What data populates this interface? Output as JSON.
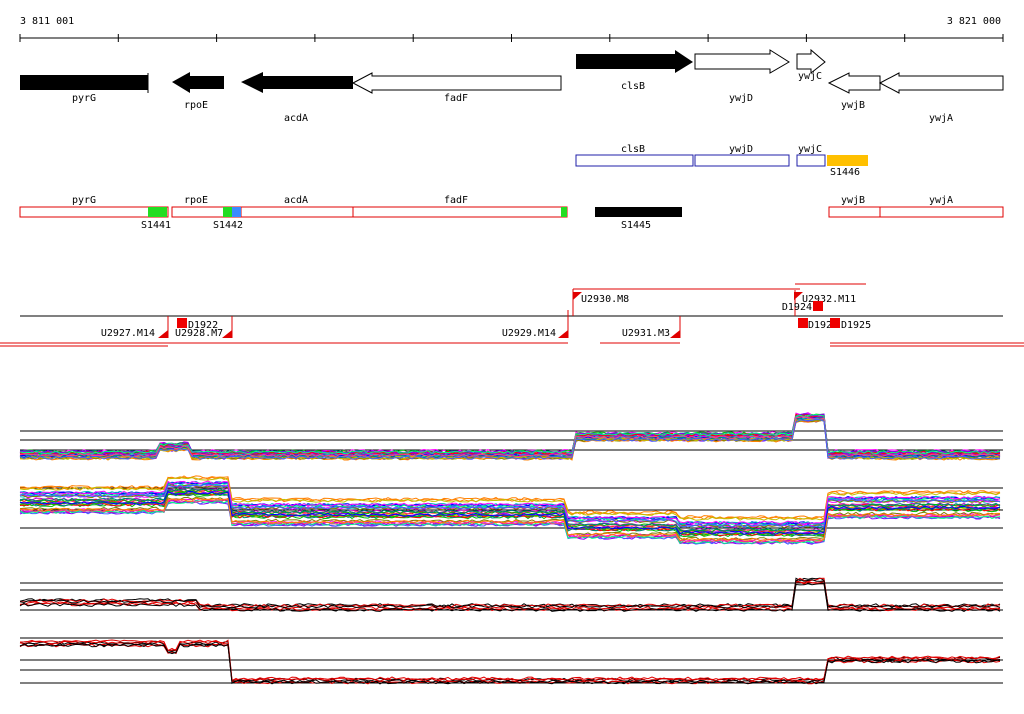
{
  "ruler": {
    "start_label": "3 811 001",
    "end_label": "3 821 000"
  },
  "genes": [
    {
      "label": "pyrG",
      "fill": "#000000"
    },
    {
      "label": "rpoE",
      "fill": "#000000"
    },
    {
      "label": "acdA",
      "fill": "#000000"
    },
    {
      "label": "fadF",
      "fill": "#ffffff"
    },
    {
      "label": "clsB",
      "fill": "#000000"
    },
    {
      "label": "ywjD",
      "fill": "#ffffff"
    },
    {
      "label": "ywjC",
      "fill": "#ffffff"
    },
    {
      "label": "ywjB",
      "fill": "#ffffff"
    },
    {
      "label": "ywjA",
      "fill": "#ffffff"
    }
  ],
  "blue_boxes": [
    "clsB",
    "ywjD",
    "ywjC"
  ],
  "red_boxes": [
    "pyrG",
    "rpoE",
    "acdA",
    "fadF",
    "ywjB",
    "ywjA"
  ],
  "segments": [
    "S1441",
    "S1442",
    "S1445",
    "S1446"
  ],
  "upshifts": [
    "U2927.M14",
    "U2928.M7",
    "U2929.M14",
    "U2930.M8",
    "U2931.M3",
    "U2932.M11"
  ],
  "downshifts": [
    "D1922",
    "D1924",
    "D1925",
    "D1926"
  ],
  "colors": {
    "outline_blue": "#1f1fa8",
    "outline_red": "#e00000",
    "seg_green": "#22dd22",
    "seg_blue": "#3a8bff",
    "seg_orange": "#ffc000",
    "marker_red": "#ee0000"
  }
}
